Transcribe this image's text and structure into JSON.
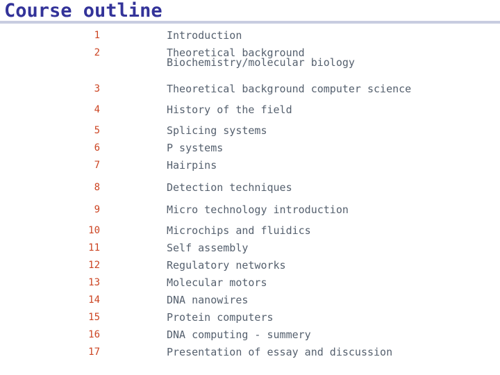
{
  "slide": {
    "title": "Course outline",
    "title_color": "#333399",
    "rule_color": "#c8cce0",
    "number_color": "#cc4422",
    "text_color": "#55606e",
    "items": [
      {
        "num": "1",
        "text": "Introduction",
        "sub": ""
      },
      {
        "num": "2",
        "text": "Theoretical background",
        "sub": "Biochemistry/molecular biology"
      },
      {
        "num": "3",
        "text": "Theoretical background computer science",
        "sub": ""
      },
      {
        "num": "4",
        "text": "History of the field",
        "sub": ""
      },
      {
        "num": "5",
        "text": "Splicing systems",
        "sub": ""
      },
      {
        "num": "6",
        "text": "P systems",
        "sub": ""
      },
      {
        "num": "7",
        "text": "Hairpins",
        "sub": ""
      },
      {
        "num": "8",
        "text": "Detection techniques",
        "sub": ""
      },
      {
        "num": "9",
        "text": "Micro technology introduction",
        "sub": ""
      },
      {
        "num": "10",
        "text": "Microchips and fluidics",
        "sub": ""
      },
      {
        "num": "11",
        "text": "Self assembly",
        "sub": ""
      },
      {
        "num": "12",
        "text": "Regulatory networks",
        "sub": ""
      },
      {
        "num": "13",
        "text": "Molecular motors",
        "sub": ""
      },
      {
        "num": "14",
        "text": "DNA nanowires",
        "sub": ""
      },
      {
        "num": "15",
        "text": "Protein computers",
        "sub": ""
      },
      {
        "num": "16",
        "text": "DNA computing - summery",
        "sub": ""
      },
      {
        "num": "17",
        "text": "Presentation of essay and discussion",
        "sub": ""
      }
    ]
  }
}
